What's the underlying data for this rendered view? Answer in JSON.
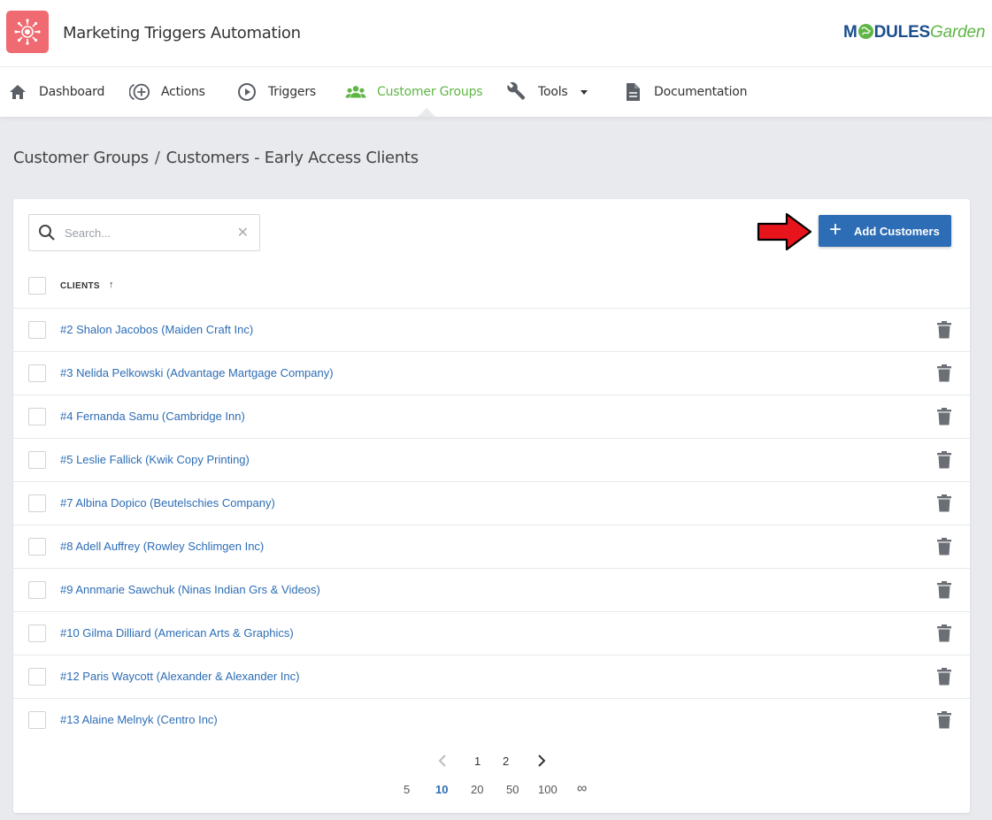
{
  "header": {
    "app_title": "Marketing Triggers Automation",
    "brand": {
      "part1": "M",
      "part2": "DULES",
      "part3": "Garden"
    },
    "colors": {
      "logo_bg": "#f06a72",
      "brand_blue": "#1b4d8c",
      "brand_green": "#5fb645"
    }
  },
  "nav": {
    "items": [
      {
        "label": "Dashboard",
        "icon": "home-icon"
      },
      {
        "label": "Actions",
        "icon": "add-circle-icon"
      },
      {
        "label": "Triggers",
        "icon": "play-circle-icon"
      },
      {
        "label": "Customer Groups",
        "icon": "group-icon",
        "active": true
      },
      {
        "label": "Tools",
        "icon": "wrench-icon",
        "dropdown": true
      },
      {
        "label": "Documentation",
        "icon": "document-icon"
      }
    ]
  },
  "breadcrumb": {
    "parent": "Customer Groups",
    "separator": "/",
    "current": "Customers - Early Access Clients"
  },
  "toolbar": {
    "search_placeholder": "Search...",
    "add_button_label": "Add Customers",
    "accent": "#2d6db5"
  },
  "table": {
    "column_header": "CLIENTS",
    "sort_indicator": "↑",
    "rows": [
      "#2 Shalon Jacobos (Maiden Craft Inc)",
      "#3 Nelida Pelkowski (Advantage Martgage Company)",
      "#4 Fernanda Samu (Cambridge Inn)",
      "#5 Leslie Fallick (Kwik Copy Printing)",
      "#7 Albina Dopico (Beutelschies Company)",
      "#8 Adell Auffrey (Rowley Schlimgen Inc)",
      "#9 Annmarie Sawchuk (Ninas Indian Grs & Videos)",
      "#10 Gilma Dilliard (American Arts & Graphics)",
      "#12 Paris Waycott (Alexander & Alexander Inc)",
      "#13 Alaine Melnyk (Centro Inc)"
    ]
  },
  "pagination": {
    "pages": [
      "1",
      "2"
    ],
    "current_page": "1",
    "page_sizes": [
      "5",
      "10",
      "20",
      "50",
      "100",
      "∞"
    ],
    "current_size": "10"
  }
}
